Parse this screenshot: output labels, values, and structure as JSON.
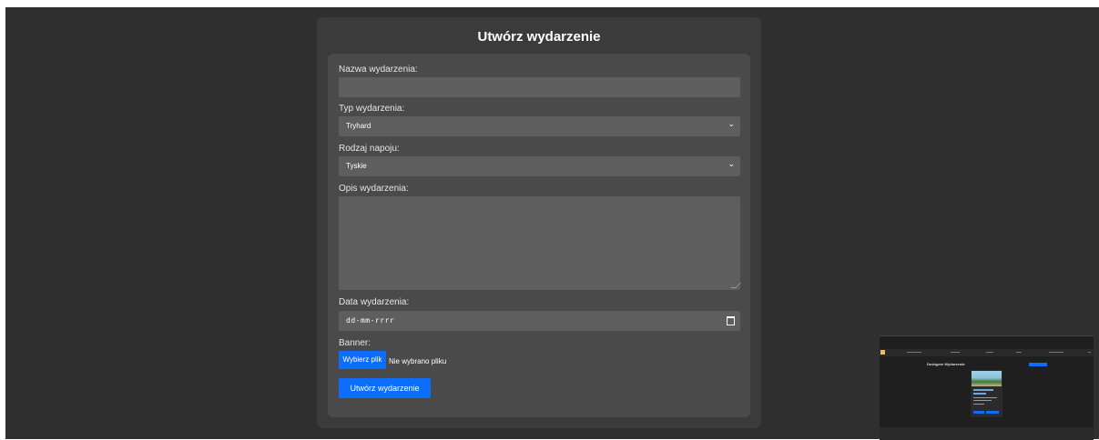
{
  "form": {
    "title": "Utwórz wydarzenie",
    "name_label": "Nazwa wydarzenia:",
    "name_value": "",
    "type_label": "Typ wydarzenia:",
    "type_value": "Tryhard",
    "drink_label": "Rodzaj napoju:",
    "drink_value": "Tyskie",
    "description_label": "Opis wydarzenia:",
    "description_value": "",
    "date_label": "Data wydarzenia:",
    "date_placeholder": "dd-mm-rrrr",
    "banner_label": "Banner:",
    "file_button": "Wybierz plik",
    "file_status": "Nie wybrano pliku",
    "submit_button": "Utwórz wydarzenie"
  },
  "thumbnail": {
    "heading": "Dostępne Wydarzenia"
  },
  "colors": {
    "page_bg": "#2f2f2f",
    "card_bg": "#3b3b3b",
    "form_bg": "#4a4a4a",
    "field_bg": "#5e5e5e",
    "accent": "#0d6efd"
  },
  "icons": {
    "select_arrow": "chevron-down-icon",
    "date_picker": "calendar-icon"
  }
}
